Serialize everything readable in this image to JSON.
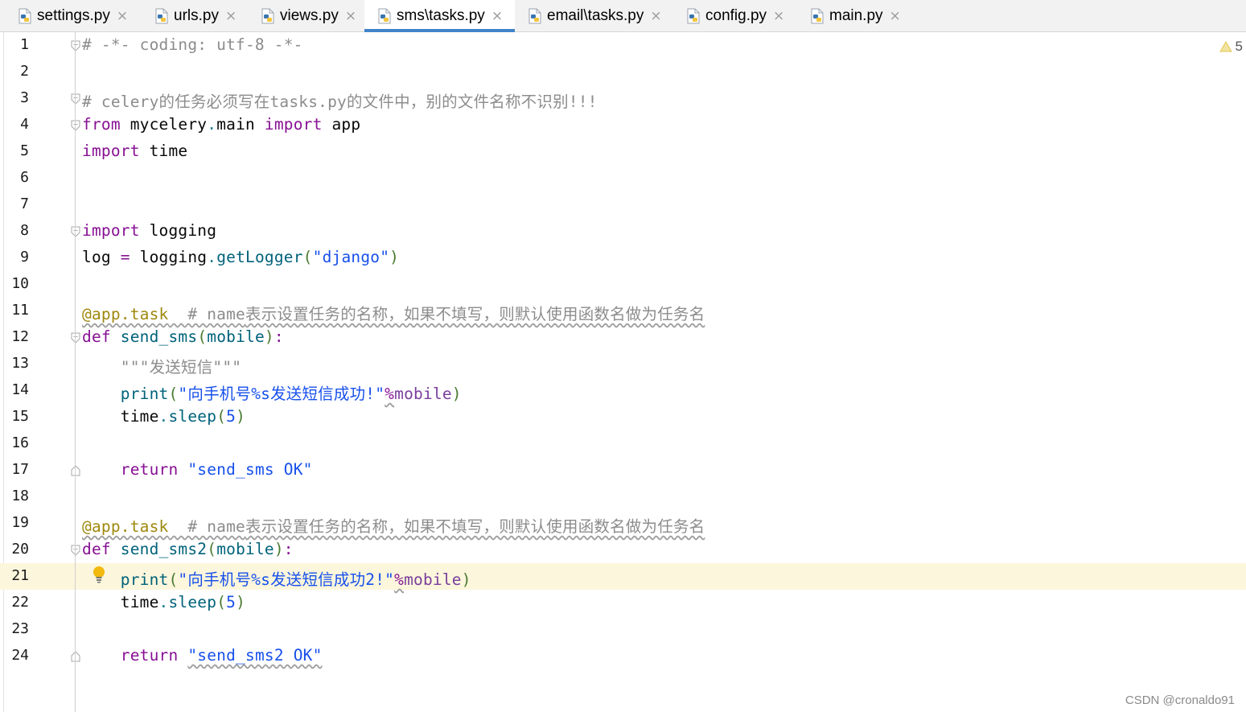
{
  "tabs": [
    {
      "label": "settings.py",
      "active": false
    },
    {
      "label": "urls.py",
      "active": false
    },
    {
      "label": "views.py",
      "active": false
    },
    {
      "label": "sms\\tasks.py",
      "active": true
    },
    {
      "label": "email\\tasks.py",
      "active": false
    },
    {
      "label": "config.py",
      "active": false
    },
    {
      "label": "main.py",
      "active": false
    }
  ],
  "close_glyph": "×",
  "warning_count": "5",
  "current_line": 21,
  "lines": [
    {
      "n": "1",
      "parts": [
        [
          "cm",
          "# -*- coding: utf-8 -*-"
        ]
      ]
    },
    {
      "n": "2",
      "parts": []
    },
    {
      "n": "3",
      "parts": [
        [
          "cm",
          "# celery"
        ],
        [
          "cm-cn",
          "的任务必须写在"
        ],
        [
          "cm",
          "tasks.py"
        ],
        [
          "cm-cn",
          "的文件中，别的文件名称不识别"
        ],
        [
          "cm",
          "!!!"
        ]
      ]
    },
    {
      "n": "4",
      "parts": [
        [
          "kw2",
          "from"
        ],
        [
          "pl",
          " mycelery"
        ],
        [
          "teal",
          "."
        ],
        [
          "pl",
          "main "
        ],
        [
          "kw2",
          "import"
        ],
        [
          "pl",
          " app"
        ]
      ]
    },
    {
      "n": "5",
      "parts": [
        [
          "kw2",
          "import"
        ],
        [
          "pl",
          " time"
        ]
      ]
    },
    {
      "n": "6",
      "parts": []
    },
    {
      "n": "7",
      "parts": []
    },
    {
      "n": "8",
      "parts": [
        [
          "kw2",
          "import"
        ],
        [
          "pl",
          " logging"
        ]
      ]
    },
    {
      "n": "9",
      "parts": [
        [
          "pl",
          "log "
        ],
        [
          "kw2",
          "="
        ],
        [
          "pl",
          " logging"
        ],
        [
          "teal",
          "."
        ],
        [
          "fn",
          "getLogger"
        ],
        [
          "paren",
          "("
        ],
        [
          "str2",
          "\"django\""
        ],
        [
          "paren",
          ")"
        ]
      ]
    },
    {
      "n": "10",
      "parts": []
    },
    {
      "n": "11",
      "parts": [
        [
          "deco wavy",
          "@app.task"
        ],
        [
          "cm wavy",
          "  # name"
        ],
        [
          "cm-cn wavy",
          "表示设置任务的名称，如果不填写，则默认使用函数名做为任务名"
        ]
      ]
    },
    {
      "n": "12",
      "parts": [
        [
          "kw2",
          "def"
        ],
        [
          "pl",
          " "
        ],
        [
          "fn",
          "send_sms"
        ],
        [
          "paren",
          "("
        ],
        [
          "fn",
          "mobile"
        ],
        [
          "paren",
          ")"
        ],
        [
          "kw2",
          ":"
        ]
      ]
    },
    {
      "n": "13",
      "parts": [
        [
          "pl",
          "    "
        ],
        [
          "cm",
          "\"\"\""
        ],
        [
          "cm-cn",
          "发送短信"
        ],
        [
          "cm",
          "\"\"\""
        ]
      ]
    },
    {
      "n": "14",
      "parts": [
        [
          "pl",
          "    "
        ],
        [
          "fn",
          "print"
        ],
        [
          "paren",
          "("
        ],
        [
          "str2",
          "\""
        ],
        [
          "cm-cn str2",
          "向手机号"
        ],
        [
          "str2",
          "%s"
        ],
        [
          "cm-cn str2",
          "发送短信成功"
        ],
        [
          "str2",
          "!\""
        ],
        [
          "kw2 wavy",
          "%"
        ],
        [
          "param",
          "mobile"
        ],
        [
          "paren",
          ")"
        ]
      ]
    },
    {
      "n": "15",
      "parts": [
        [
          "pl",
          "    time"
        ],
        [
          "teal",
          "."
        ],
        [
          "fn",
          "sleep"
        ],
        [
          "paren",
          "("
        ],
        [
          "str2",
          "5"
        ],
        [
          "paren",
          ")"
        ]
      ]
    },
    {
      "n": "16",
      "parts": []
    },
    {
      "n": "17",
      "parts": [
        [
          "pl",
          "    "
        ],
        [
          "kw2",
          "return"
        ],
        [
          "pl",
          " "
        ],
        [
          "str2",
          "\"send_sms OK\""
        ]
      ]
    },
    {
      "n": "18",
      "parts": []
    },
    {
      "n": "19",
      "parts": [
        [
          "deco wavy",
          "@app.task"
        ],
        [
          "cm wavy",
          "  # name"
        ],
        [
          "cm-cn wavy",
          "表示设置任务的名称，如果不填写，则默认使用函数名做为任务名"
        ]
      ]
    },
    {
      "n": "20",
      "parts": [
        [
          "kw2",
          "def"
        ],
        [
          "pl",
          " "
        ],
        [
          "fn",
          "send_sms2"
        ],
        [
          "paren",
          "("
        ],
        [
          "fn",
          "mobile"
        ],
        [
          "paren",
          ")"
        ],
        [
          "kw2",
          ":"
        ]
      ]
    },
    {
      "n": "21",
      "parts": [
        [
          "pl",
          "    "
        ],
        [
          "fn",
          "print"
        ],
        [
          "paren",
          "("
        ],
        [
          "str2",
          "\""
        ],
        [
          "cm-cn str2",
          "向手机号"
        ],
        [
          "str2",
          "%s"
        ],
        [
          "cm-cn str2",
          "发送短信成功"
        ],
        [
          "str2",
          "2!\""
        ],
        [
          "kw2 wavy",
          "%"
        ],
        [
          "param",
          "mobile"
        ],
        [
          "paren",
          ")"
        ]
      ]
    },
    {
      "n": "22",
      "parts": [
        [
          "pl",
          "    time"
        ],
        [
          "teal",
          "."
        ],
        [
          "fn",
          "sleep"
        ],
        [
          "paren",
          "("
        ],
        [
          "str2",
          "5"
        ],
        [
          "paren",
          ")"
        ]
      ]
    },
    {
      "n": "23",
      "parts": []
    },
    {
      "n": "24",
      "parts": [
        [
          "pl",
          "    "
        ],
        [
          "kw2",
          "return"
        ],
        [
          "pl",
          " "
        ],
        [
          "str2 wavy",
          "\"send_sms2 OK\""
        ]
      ]
    }
  ],
  "fold_markers": {
    "open": [
      "1",
      "3",
      "4",
      "8",
      "12",
      "20"
    ],
    "close": [
      "17",
      "24"
    ]
  },
  "watermark": "CSDN @cronaldo91"
}
